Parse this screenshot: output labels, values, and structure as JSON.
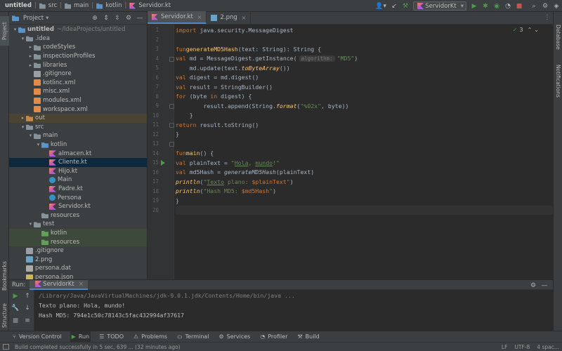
{
  "breadcrumb": [
    "untitled",
    "src",
    "main",
    "kotlin",
    "Servidor.kt"
  ],
  "run_config": "ServidorKt",
  "project_panel": {
    "title": "Project",
    "tree": [
      {
        "label": "untitled",
        "extra": "~/IdeaProjects/untitled",
        "type": "folder-blue",
        "indent": 0,
        "arrow": "down"
      },
      {
        "label": ".idea",
        "type": "folder",
        "indent": 1,
        "arrow": "down"
      },
      {
        "label": "codeStyles",
        "type": "folder",
        "indent": 2,
        "arrow": "right"
      },
      {
        "label": "inspectionProfiles",
        "type": "folder",
        "indent": 2,
        "arrow": "right"
      },
      {
        "label": "libraries",
        "type": "folder",
        "indent": 2,
        "arrow": "right"
      },
      {
        "label": ".gitignore",
        "type": "gfile",
        "indent": 2,
        "arrow": ""
      },
      {
        "label": "kotlinc.xml",
        "type": "xfile",
        "indent": 2,
        "arrow": ""
      },
      {
        "label": "misc.xml",
        "type": "xfile",
        "indent": 2,
        "arrow": ""
      },
      {
        "label": "modules.xml",
        "type": "xfile",
        "indent": 2,
        "arrow": ""
      },
      {
        "label": "workspace.xml",
        "type": "xfile",
        "indent": 2,
        "arrow": ""
      },
      {
        "label": "out",
        "type": "folder-orange",
        "indent": 1,
        "arrow": "right",
        "row": "brown"
      },
      {
        "label": "src",
        "type": "folder",
        "indent": 1,
        "arrow": "down"
      },
      {
        "label": "main",
        "type": "folder",
        "indent": 2,
        "arrow": "down"
      },
      {
        "label": "kotlin",
        "type": "folder-blue",
        "indent": 3,
        "arrow": "down"
      },
      {
        "label": "almacen.kt",
        "type": "kfile",
        "indent": 4,
        "arrow": ""
      },
      {
        "label": "Cliente.kt",
        "type": "kfile",
        "indent": 4,
        "arrow": "",
        "row": "sel"
      },
      {
        "label": "Hijo.kt",
        "type": "kfile",
        "indent": 4,
        "arrow": ""
      },
      {
        "label": "Main",
        "type": "kclass",
        "indent": 4,
        "arrow": ""
      },
      {
        "label": "Padre.kt",
        "type": "kfile",
        "indent": 4,
        "arrow": ""
      },
      {
        "label": "Persona",
        "type": "kclass",
        "indent": 4,
        "arrow": ""
      },
      {
        "label": "Servidor.kt",
        "type": "kfile",
        "indent": 4,
        "arrow": ""
      },
      {
        "label": "resources",
        "type": "folder",
        "indent": 3,
        "arrow": ""
      },
      {
        "label": "test",
        "type": "folder",
        "indent": 2,
        "arrow": "down"
      },
      {
        "label": "kotlin",
        "type": "folder-green",
        "indent": 3,
        "arrow": "",
        "row": "green"
      },
      {
        "label": "resources",
        "type": "folder-green",
        "indent": 3,
        "arrow": "",
        "row": "green"
      },
      {
        "label": ".gitignore",
        "type": "gfile",
        "indent": 1,
        "arrow": ""
      },
      {
        "label": "2.png",
        "type": "imgfile",
        "indent": 1,
        "arrow": ""
      },
      {
        "label": "persona.dat",
        "type": "datfile",
        "indent": 1,
        "arrow": ""
      },
      {
        "label": "persona.json",
        "type": "json",
        "indent": 1,
        "arrow": ""
      }
    ]
  },
  "tabs": [
    {
      "label": "Servidor.kt",
      "active": true
    },
    {
      "label": "2.png",
      "active": false
    }
  ],
  "editor": {
    "inspection_count": "3",
    "line_numbers": [
      "1",
      "2",
      "3",
      "4",
      "5",
      "6",
      "7",
      "8",
      "9",
      "10",
      "11",
      "12",
      "13",
      "14",
      "15",
      "16",
      "17",
      "18",
      "19",
      "20"
    ]
  },
  "left_stripe": {
    "project": "Project",
    "bookmarks": "Bookmarks",
    "structure": "Structure"
  },
  "right_stripe": {
    "database": "Database",
    "notifications": "Notifications"
  },
  "run_panel": {
    "label": "Run:",
    "tab": "ServidorKt",
    "console": [
      "/Library/Java/JavaVirtualMachines/jdk-9.0.1.jdk/Contents/Home/bin/java ...",
      "Texto plano: Hola, mundo!",
      "Hash MD5: 794e1c50c78143c5fac432994af37617"
    ]
  },
  "bottom_tools": [
    {
      "label": "Version Control",
      "icon": "vcs-icon"
    },
    {
      "label": "Run",
      "icon": "run-icon",
      "active": true
    },
    {
      "label": "TODO",
      "icon": "todo-icon"
    },
    {
      "label": "Problems",
      "icon": "problems-icon"
    },
    {
      "label": "Terminal",
      "icon": "terminal-icon"
    },
    {
      "label": "Services",
      "icon": "services-icon"
    },
    {
      "label": "Profiler",
      "icon": "profiler-icon"
    },
    {
      "label": "Build",
      "icon": "build-icon"
    }
  ],
  "status": {
    "message": "Build completed successfully in 5 sec, 639 ... (32 minutes ago)",
    "line_sep": "LF",
    "encoding": "UTF-8",
    "indent": "4 spac..."
  }
}
